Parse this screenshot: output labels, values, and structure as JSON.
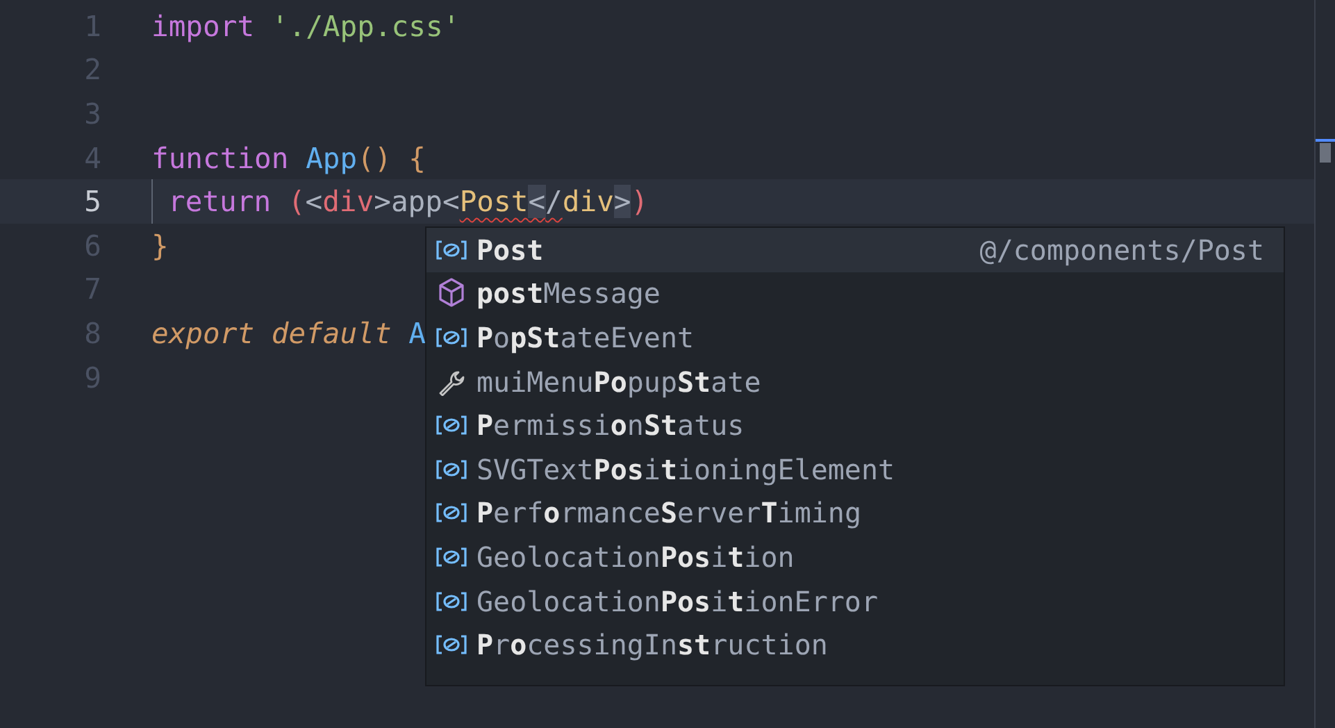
{
  "editor": {
    "lines": [
      {
        "number": "1",
        "active": false,
        "guide": false,
        "words": [
          {
            "tokens": [
              {
                "text": "import",
                "kind": "keyword"
              }
            ]
          },
          {
            "tokens": [
              {
                "text": "'./App.css'",
                "kind": "string"
              }
            ]
          }
        ]
      },
      {
        "number": "2",
        "active": false,
        "guide": false
      },
      {
        "number": "3",
        "active": false,
        "guide": false
      },
      {
        "number": "4",
        "active": false,
        "guide": false,
        "words": [
          {
            "tokens": [
              {
                "text": "function",
                "kind": "keyword"
              }
            ]
          },
          {
            "tokens": [
              {
                "text": "App",
                "kind": "function"
              },
              {
                "text": "()",
                "kind": "paren"
              }
            ]
          },
          {
            "tokens": [
              {
                "text": "{",
                "kind": "paren"
              }
            ]
          }
        ]
      },
      {
        "number": "5",
        "active": true,
        "guide": true,
        "words": [
          {
            "tokens": [
              {
                "text": "return",
                "kind": "keyword",
                "error": false,
                "matched": false
              }
            ]
          },
          {
            "tokens": [
              {
                "text": "(",
                "kind": "tag",
                "error": false,
                "matched": false
              },
              {
                "text": "<",
                "kind": "punct",
                "error": false,
                "matched": false
              },
              {
                "text": "div",
                "kind": "tag",
                "error": false,
                "matched": false
              },
              {
                "text": ">app<",
                "kind": "punct",
                "error": false,
                "matched": false
              },
              {
                "text": "Post",
                "kind": "component",
                "error": true,
                "matched": false
              },
              {
                "text": "<",
                "kind": "punct",
                "error": true,
                "matched": true
              },
              {
                "text": "/",
                "kind": "punct",
                "error": true,
                "matched": false
              },
              {
                "text": "div",
                "kind": "component",
                "error": false,
                "matched": false
              },
              {
                "text": ">",
                "kind": "punct",
                "error": false,
                "matched": true
              },
              {
                "text": ")",
                "kind": "tag",
                "error": false,
                "matched": false
              }
            ]
          }
        ]
      },
      {
        "number": "6",
        "active": false,
        "guide": false,
        "words": [
          {
            "tokens": [
              {
                "text": "}",
                "kind": "paren"
              }
            ]
          }
        ]
      },
      {
        "number": "7",
        "active": false,
        "guide": false
      },
      {
        "number": "8",
        "active": false,
        "guide": false,
        "words": [
          {
            "tokens": [
              {
                "text": "export default",
                "kind": "modifier"
              }
            ]
          },
          {
            "tokens": [
              {
                "text": "A",
                "kind": "function"
              }
            ]
          }
        ]
      },
      {
        "number": "9",
        "active": false,
        "guide": false
      }
    ]
  },
  "suggestions": [
    {
      "label": "**Post**",
      "kind": "variable",
      "selected": true,
      "detail": "@/components/Post"
    },
    {
      "label": "**post**Message",
      "kind": "module",
      "selected": false
    },
    {
      "label": "**P**o**pSt**ateEvent",
      "kind": "variable",
      "selected": false
    },
    {
      "label": "muiMenu**Po**pup**St**ate",
      "kind": "utility",
      "selected": false
    },
    {
      "label": "**P**ermissi**o**n**St**atus",
      "kind": "variable",
      "selected": false
    },
    {
      "label": "SVGText**Pos**i**t**ioningElement",
      "kind": "variable",
      "selected": false
    },
    {
      "label": "**P**erf**o**rmance**S**erver**T**iming",
      "kind": "variable",
      "selected": false
    },
    {
      "label": "Geolocation**Pos**i**t**ion",
      "kind": "variable",
      "selected": false
    },
    {
      "label": "Geolocation**Pos**i**t**ionError",
      "kind": "variable",
      "selected": false
    },
    {
      "label": "**P**r**o**cessingIn**st**ruction",
      "kind": "variable",
      "selected": false
    }
  ]
}
